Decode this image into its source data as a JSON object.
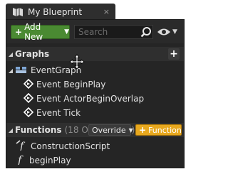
{
  "tab": {
    "title": "My Blueprint",
    "close_glyph": "×",
    "icon": "blueprint-icon"
  },
  "toolbar": {
    "add_new_label": "Add New",
    "search_placeholder": "Search",
    "search_icon": "search-icon",
    "view_icon": "eye-icon"
  },
  "graphs": {
    "label": "Graphs",
    "event_graph": {
      "label": "EventGraph",
      "events": [
        {
          "label": "Event BeginPlay"
        },
        {
          "label": "Event ActorBeginOverlap"
        },
        {
          "label": "Event Tick"
        }
      ]
    }
  },
  "functions": {
    "label": "Functions",
    "count_text": "(18 Overridable)",
    "override_label": "Override",
    "add_function_label": "Function",
    "items": [
      {
        "label": "ConstructionScript",
        "icon": "construction-function-icon"
      },
      {
        "label": "beginPlay",
        "icon": "function-icon"
      }
    ]
  },
  "colors": {
    "add_new_green": "#4a8a32",
    "function_orange": "#e8a81e",
    "panel_bg": "#252525"
  }
}
